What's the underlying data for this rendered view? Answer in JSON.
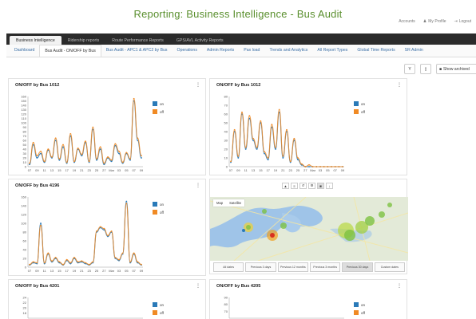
{
  "header": {
    "title": "Reporting: Business Intelligence - Bus Audit",
    "links": [
      "Accounts",
      "My Profile",
      "Logout"
    ]
  },
  "top_tabs": [
    "Business Intelligence",
    "Ridership reports",
    "Route Performance Reports",
    "GPS/AVL Activity Reports"
  ],
  "sub_tabs": [
    "Dashboard",
    "Bus Audit - ON/OFF by Bus",
    "Bus Audit - APC1 & APC2 by Bus",
    "Operations",
    "Admin Reports",
    "Pax load",
    "Trends and Analytics",
    "All Report Types",
    "Global Time Reports",
    "SR Admin"
  ],
  "toolbar": {
    "filter_icon": "filter-icon",
    "export_icon": "document-icon",
    "show_archived": "Show archived"
  },
  "panels": [
    {
      "title": "ON/OFF by Bus 1012",
      "menu": "⋮"
    },
    {
      "title": "ON/OFF by Bus 1012",
      "menu": "⋮"
    },
    {
      "title": "ON/OFF by Bus 4196",
      "menu": "⋮"
    },
    {
      "title": "ON/OFF by Bus 4201",
      "menu": "⋮"
    },
    {
      "title": "ON/OFF by Bus 4205",
      "menu": "⋮"
    }
  ],
  "legend": {
    "on": "on",
    "off": "off"
  },
  "colors": {
    "on": "#2a7ab8",
    "off": "#f08a24",
    "accent": "#5a8f2e"
  },
  "map": {
    "type_options": [
      "Map",
      "Satellite"
    ],
    "range_buttons": [
      "All dates",
      "Previous 3 days",
      "Previous 12 months",
      "Previous 3 months",
      "Previous 30 days",
      "Custom dates"
    ],
    "tools": [
      "▲",
      "≡",
      "↺",
      "⚙",
      "■",
      "↓"
    ]
  },
  "chart_data": [
    {
      "type": "line",
      "panel": "ON/OFF by Bus 1012",
      "x": [
        "07",
        "09",
        "11",
        "13",
        "15",
        "17",
        "19",
        "21",
        "23",
        "25",
        "27",
        "Mar",
        "03",
        "05",
        "07",
        "09"
      ],
      "yticks": [
        0,
        10,
        20,
        30,
        40,
        50,
        60,
        70,
        80,
        90,
        100,
        110,
        120,
        130,
        140,
        150,
        160
      ],
      "ylim": [
        0,
        160
      ],
      "series": [
        {
          "name": "on",
          "values": [
            5,
            50,
            20,
            30,
            10,
            38,
            20,
            60,
            15,
            45,
            8,
            70,
            10,
            40,
            25,
            55,
            10,
            85,
            15,
            40,
            5,
            20,
            12,
            48,
            30,
            8,
            30,
            15,
            150,
            60,
            20
          ]
        },
        {
          "name": "off",
          "values": [
            8,
            55,
            25,
            35,
            12,
            40,
            22,
            65,
            18,
            50,
            10,
            75,
            12,
            42,
            28,
            58,
            12,
            90,
            18,
            45,
            8,
            22,
            15,
            52,
            35,
            10,
            32,
            18,
            155,
            65,
            25
          ]
        }
      ]
    },
    {
      "type": "line",
      "panel": "ON/OFF by Bus 1012",
      "x": [
        "07",
        "09",
        "11",
        "13",
        "15",
        "17",
        "19",
        "21",
        "23",
        "25",
        "27",
        "Mar",
        "03",
        "05",
        "07",
        "09"
      ],
      "yticks": [
        0,
        10,
        20,
        30,
        40,
        50,
        60,
        70,
        80
      ],
      "ylim": [
        0,
        80
      ],
      "series": [
        {
          "name": "on",
          "values": [
            5,
            40,
            10,
            60,
            20,
            55,
            30,
            20,
            50,
            15,
            8,
            45,
            20,
            62,
            10,
            40,
            5,
            30,
            8,
            2,
            0,
            0,
            0,
            0,
            0,
            0,
            0,
            0,
            0,
            0,
            0
          ]
        },
        {
          "name": "off",
          "values": [
            6,
            42,
            12,
            62,
            22,
            58,
            32,
            22,
            52,
            17,
            10,
            48,
            22,
            65,
            12,
            42,
            6,
            32,
            10,
            3,
            0,
            2,
            0,
            0,
            0,
            0,
            0,
            0,
            0,
            0,
            0
          ]
        }
      ]
    },
    {
      "type": "line",
      "panel": "ON/OFF by Bus 4196",
      "x": [
        "07",
        "09",
        "11",
        "13",
        "15",
        "17",
        "19",
        "21",
        "23",
        "25",
        "27",
        "Mar",
        "03",
        "05",
        "07",
        "09"
      ],
      "yticks": [
        0,
        20,
        40,
        60,
        80,
        100,
        120,
        140,
        160
      ],
      "ylim": [
        0,
        160
      ],
      "series": [
        {
          "name": "on",
          "values": [
            5,
            10,
            8,
            100,
            8,
            30,
            12,
            20,
            10,
            5,
            15,
            8,
            20,
            10,
            12,
            8,
            5,
            10,
            80,
            90,
            85,
            70,
            80,
            20,
            15,
            30,
            150,
            10,
            30,
            10,
            5
          ]
        },
        {
          "name": "off",
          "values": [
            6,
            12,
            10,
            95,
            10,
            32,
            14,
            22,
            12,
            6,
            17,
            10,
            22,
            12,
            14,
            10,
            6,
            12,
            82,
            92,
            88,
            72,
            82,
            22,
            17,
            32,
            145,
            12,
            32,
            12,
            6
          ]
        }
      ]
    },
    {
      "type": "line",
      "panel": "ON/OFF by Bus 4201",
      "x": [],
      "yticks": [
        18,
        20,
        22,
        24
      ],
      "ylim": [
        16,
        24
      ],
      "series": [
        {
          "name": "on",
          "values": []
        },
        {
          "name": "off",
          "values": []
        }
      ]
    },
    {
      "type": "line",
      "panel": "ON/OFF by Bus 4205",
      "x": [],
      "yticks": [
        70,
        80,
        90
      ],
      "ylim": [
        60,
        90
      ],
      "series": [
        {
          "name": "on",
          "values": []
        },
        {
          "name": "off",
          "values": []
        }
      ]
    }
  ]
}
